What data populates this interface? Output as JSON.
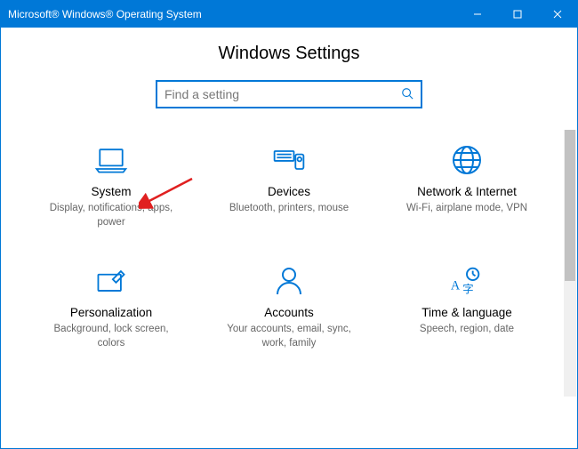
{
  "window": {
    "title": "Microsoft® Windows® Operating System"
  },
  "page": {
    "title": "Windows Settings"
  },
  "search": {
    "placeholder": "Find a setting",
    "value": ""
  },
  "tiles": [
    {
      "label": "System",
      "desc": "Display, notifications, apps, power"
    },
    {
      "label": "Devices",
      "desc": "Bluetooth, printers, mouse"
    },
    {
      "label": "Network & Internet",
      "desc": "Wi-Fi, airplane mode, VPN"
    },
    {
      "label": "Personalization",
      "desc": "Background, lock screen, colors"
    },
    {
      "label": "Accounts",
      "desc": "Your accounts, email, sync, work, family"
    },
    {
      "label": "Time & language",
      "desc": "Speech, region, date"
    }
  ],
  "colors": {
    "accent": "#0078d7"
  }
}
